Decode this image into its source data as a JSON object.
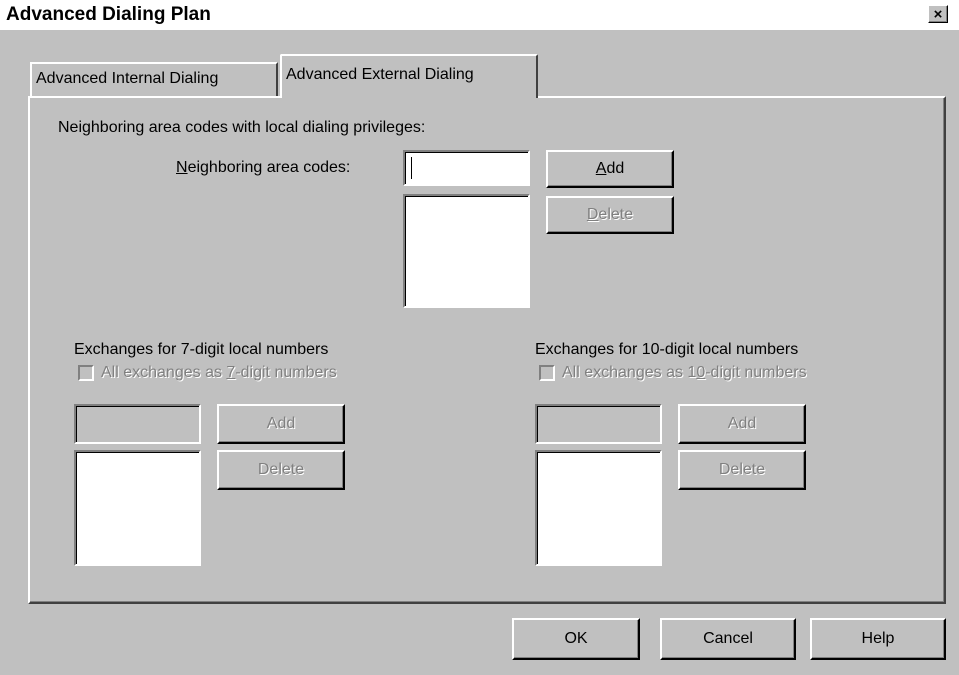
{
  "window": {
    "title": "Advanced Dialing Plan",
    "close_icon": "×"
  },
  "tabs": [
    {
      "label": "Advanced Internal Dialing",
      "active": false
    },
    {
      "label": "Advanced External Dialing",
      "active": true
    }
  ],
  "neighboring": {
    "section_label": "Neighboring area codes with local dialing privileges:",
    "field_label_mnemonic": "N",
    "field_label_rest": "eighboring area codes:",
    "input_value": "",
    "add_mnemonic": "A",
    "add_rest": "dd",
    "delete_mnemonic": "D",
    "delete_rest": "elete"
  },
  "seven_digit": {
    "title": "Exchanges for 7-digit local numbers",
    "checkbox_pre": "All exchanges as ",
    "checkbox_mnemonic": "7",
    "checkbox_post": "-digit numbers",
    "checked": false,
    "add_label": "Add",
    "delete_label": "Delete"
  },
  "ten_digit": {
    "title": "Exchanges for 10-digit local numbers",
    "checkbox_pre": "All exchanges as 1",
    "checkbox_mnemonic": "0",
    "checkbox_post": "-digit numbers",
    "checked": false,
    "add_label": "Add",
    "delete_label": "Delete"
  },
  "footer": {
    "ok_label": "OK",
    "cancel_label": "Cancel",
    "help_label": "Help"
  }
}
